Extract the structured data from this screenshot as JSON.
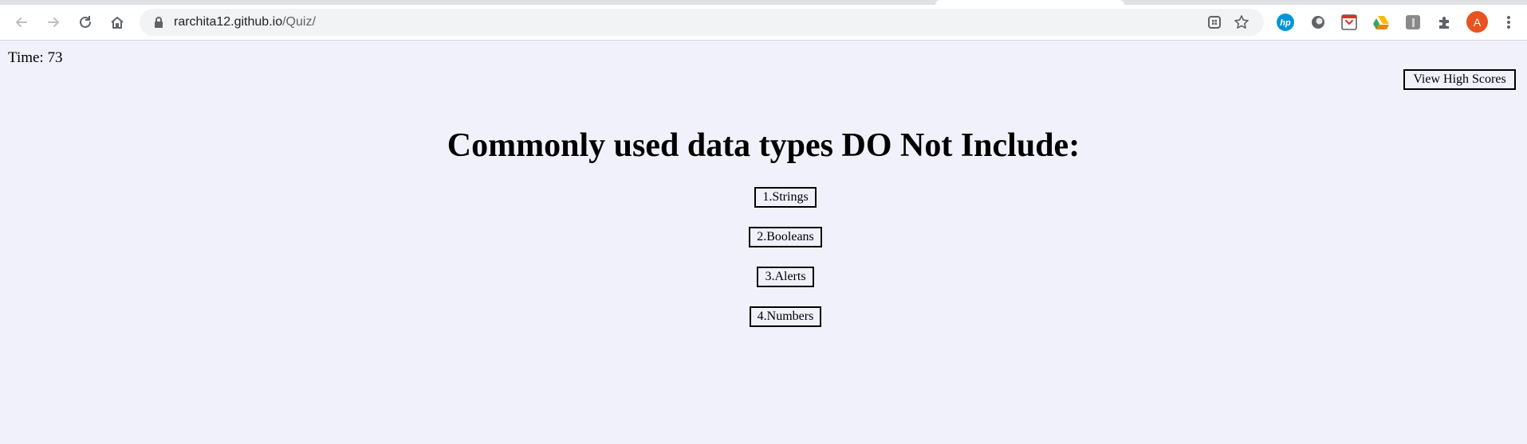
{
  "browser": {
    "url_host": "rarchita12.github.io",
    "url_path": "/Quiz/",
    "profile_initial": "A",
    "extensions": [
      "hp-icon",
      "circle-extension-icon",
      "pocket-icon",
      "google-drive-icon",
      "grey-extension-icon",
      "puzzle-icon"
    ]
  },
  "quiz": {
    "timer_label": "Time: 73",
    "high_scores_label": "View High Scores",
    "question": "Commonly used data types DO Not Include:",
    "answers": [
      "1.Strings",
      "2.Booleans",
      "3.Alerts",
      "4.Numbers"
    ]
  }
}
